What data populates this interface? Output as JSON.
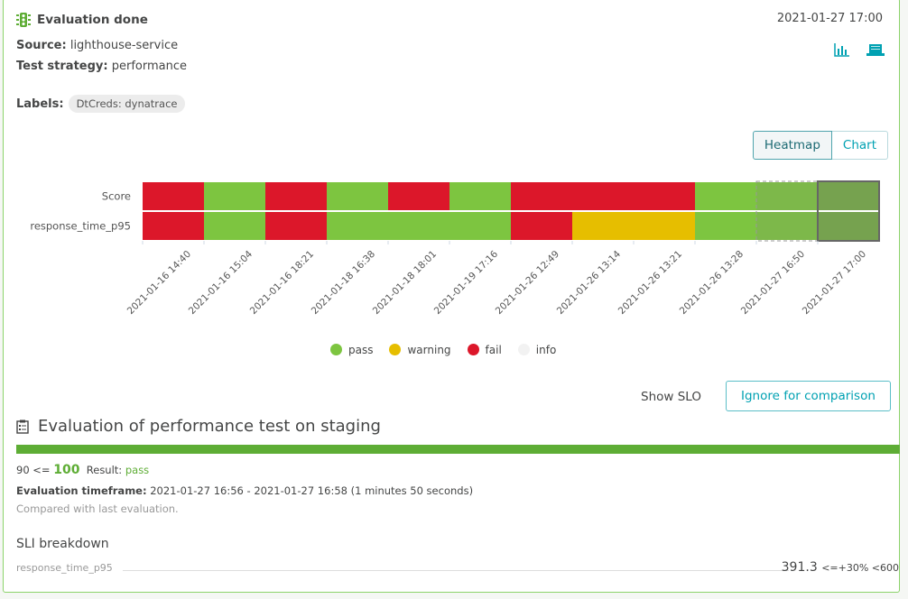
{
  "header": {
    "title": "Evaluation done",
    "source_label": "Source:",
    "source_value": "lighthouse-service",
    "strategy_label": "Test strategy:",
    "strategy_value": "performance",
    "labels_label": "Labels:",
    "labels": [
      "DtCreds: dynatrace"
    ],
    "date": "2021-01-27 17:00",
    "icons": [
      "bar-chart-icon",
      "laptop-icon"
    ]
  },
  "view_toggle": {
    "options": [
      "Heatmap",
      "Chart"
    ],
    "selected": "Heatmap"
  },
  "colors": {
    "pass": "#7dc540",
    "warning": "#e6be00",
    "fail": "#dc172a",
    "info": "#f2f2f2",
    "accent": "#00a1b2"
  },
  "chart_data": {
    "type": "heatmap",
    "rows": [
      "Score",
      "response_time_p95"
    ],
    "columns": [
      "2021-01-16 14:40",
      "2021-01-16 15:04",
      "2021-01-16 18:21",
      "2021-01-18 16:38",
      "2021-01-18 18:01",
      "2021-01-19 17:16",
      "2021-01-26 12:49",
      "2021-01-26 13:14",
      "2021-01-26 13:21",
      "2021-01-26 13:28",
      "2021-01-27 16:50",
      "2021-01-27 17:00"
    ],
    "values": [
      [
        "fail",
        "pass",
        "fail",
        "pass",
        "fail",
        "pass",
        "fail",
        "fail",
        "fail",
        "pass",
        "pass",
        "pass"
      ],
      [
        "fail",
        "pass",
        "fail",
        "pass",
        "pass",
        "pass",
        "fail",
        "warning",
        "warning",
        "pass",
        "pass",
        "pass"
      ]
    ],
    "compared_column": "2021-01-27 16:50",
    "selected_column": "2021-01-27 17:00",
    "legend": [
      "pass",
      "warning",
      "fail",
      "info"
    ]
  },
  "actions": {
    "show_slo": "Show SLO",
    "ignore": "Ignore for comparison"
  },
  "evaluation": {
    "title": "Evaluation of performance test on staging",
    "threshold": "90 <=",
    "score": "100",
    "result_label": "Result:",
    "result": "pass",
    "timeframe_label": "Evaluation timeframe:",
    "timeframe": "2021-01-27 16:56 - 2021-01-27 16:58 (1 minutes 50 seconds)",
    "compared": "Compared with last evaluation."
  },
  "sli": {
    "title": "SLI breakdown",
    "items": [
      {
        "name": "response_time_p95",
        "value": "391.3",
        "criteria": "<=+30% <600"
      }
    ]
  }
}
